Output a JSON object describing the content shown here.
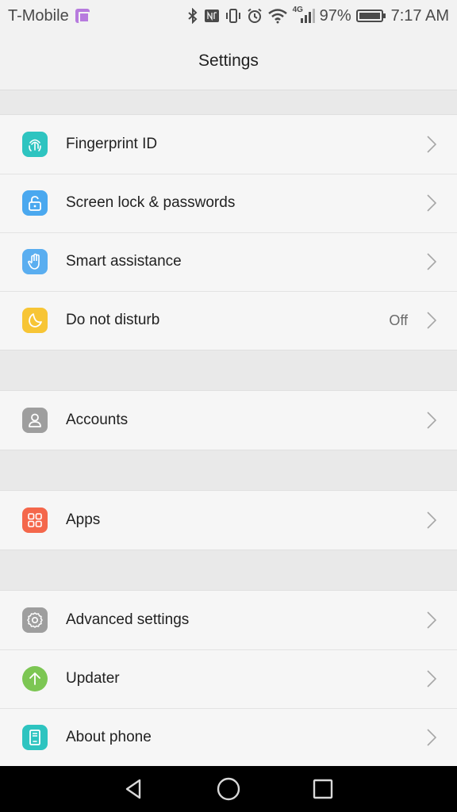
{
  "status_bar": {
    "carrier": "T-Mobile",
    "network": "4G",
    "battery_percent": "97%",
    "time": "7:17 AM",
    "icons": [
      "bluetooth-icon",
      "nfc-icon",
      "vibrate-icon",
      "alarm-icon",
      "wifi-icon",
      "signal-icon",
      "battery-icon"
    ]
  },
  "header": {
    "title": "Settings"
  },
  "groups": [
    {
      "items": [
        {
          "label": "Fingerprint ID",
          "icon": "fingerprint-icon",
          "color": "#2ec4c0"
        },
        {
          "label": "Screen lock & passwords",
          "icon": "lock-open-icon",
          "color": "#4aa8ef"
        },
        {
          "label": "Smart assistance",
          "icon": "hand-icon",
          "color": "#5aaef0"
        },
        {
          "label": "Do not disturb",
          "icon": "moon-icon",
          "color": "#f7c535",
          "value": "Off"
        }
      ]
    },
    {
      "items": [
        {
          "label": "Accounts",
          "icon": "person-icon",
          "color": "#9e9e9e"
        }
      ]
    },
    {
      "items": [
        {
          "label": "Apps",
          "icon": "apps-grid-icon",
          "color": "#f4674b"
        }
      ]
    },
    {
      "items": [
        {
          "label": "Advanced settings",
          "icon": "gear-icon",
          "color": "#9e9e9e"
        },
        {
          "label": "Updater",
          "icon": "arrow-up-icon",
          "color": "#7cc653"
        },
        {
          "label": "About phone",
          "icon": "phone-icon",
          "color": "#2ec4c0"
        }
      ]
    }
  ],
  "nav": {
    "icons": [
      "back-icon",
      "home-icon",
      "recents-icon"
    ]
  }
}
